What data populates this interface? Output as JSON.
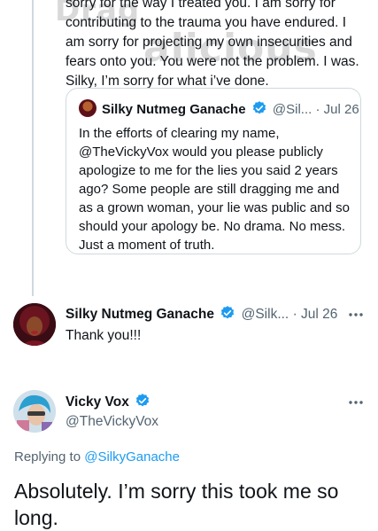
{
  "watermark": {
    "line1": "Drag",
    "line2": "alicious"
  },
  "tweet1": {
    "text": "sorry for the way I treated you. I am sorry for\ncontributing to the trauma you have endured. I\nam sorry for projecting my own insecurities and\nfears onto you. You were not the problem. I was.\nSilky, I’m sorry for what i’ve done."
  },
  "quote": {
    "name": "Silky Nutmeg Ganache",
    "handle": "@Sil...",
    "separator": "·",
    "date": "Jul 26",
    "text": "In the efforts of clearing my name,\n@TheVickyVox would you please publicly\napologize to me for the lies you said 2 years\nago?  Some people are still dragging me and\nas a grown woman, your lie was public and so\nshould your apology be. No drama. No mess.\nJust a moment of truth."
  },
  "tweet2": {
    "name": "Silky Nutmeg Ganache",
    "handle": "@Silk...",
    "separator": "·",
    "date": "Jul 26",
    "text": "Thank you!!!"
  },
  "tweet3": {
    "name": "Vicky Vox",
    "handle": "@TheVickyVox",
    "replying_prefix": "Replying to",
    "replying_to": "@SilkyGanache",
    "text": "Absolutely. I’m sorry this took me so\nlong."
  },
  "colors": {
    "accent": "#1d9bf0",
    "muted": "#536471",
    "border": "#cfd9de"
  },
  "icons": {
    "verified": "verified-badge-icon",
    "more": "more-options-icon"
  }
}
